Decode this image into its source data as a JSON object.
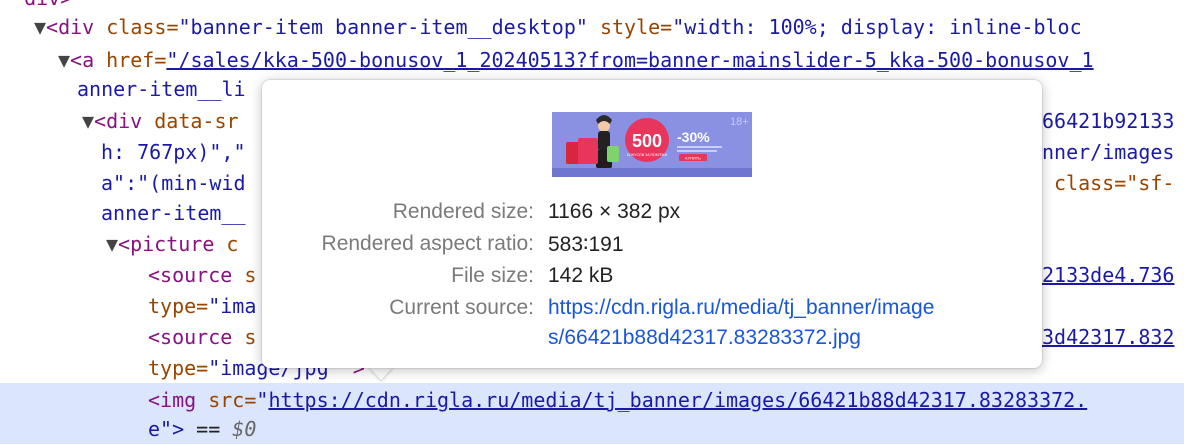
{
  "dom_lines": [
    {
      "indent": "  ",
      "arrow": "",
      "text_a": "div>",
      "cls": "tag"
    },
    {
      "arrow": "▼",
      "tag": "<div",
      "a1": " class=",
      "v1": "\"banner-item banner-item__desktop\"",
      "a2": " style=",
      "v2": "\"width: 100%; display: inline-bloc"
    },
    {
      "arrow": "▼",
      "tag": "<a",
      "a1": " href=",
      "v1": "\"/sales/kka-500-bonusov_1_20240513?from=banner-mainslider-5_kka-500-bonusov_1"
    },
    {
      "text": "anner-item__li"
    },
    {
      "arrow": "▼",
      "tag": "<div",
      "a1": " data-sr",
      "right": "66421b92133"
    },
    {
      "text": "h: 767px)\",\"",
      "right": "nner/images"
    },
    {
      "text": "a\":\"(min-wid",
      "right": "class=\"sf-"
    },
    {
      "text": "anner-item__"
    },
    {
      "arrow": "▼",
      "tag": "<picture",
      "tail": " c"
    },
    {
      "tag": "<source",
      "tail": " s",
      "right": "2133de4.736"
    },
    {
      "a1": "type=",
      "v1": "\"ima"
    },
    {
      "tag": "<source",
      "tail": " s",
      "right": "3d42317.832"
    },
    {
      "a1": "type=",
      "v1": "\"image/jpg\"",
      "tail": " >"
    },
    {
      "tag": "<img",
      "a1": " src=",
      "v1": "\"",
      "link": "https://cdn.rigla.ru/media/tj_banner/images/66421b88d42317.83283372."
    },
    {
      "text": "e\">",
      "eq": " == ",
      "dollar": "$0"
    }
  ],
  "tooltip": {
    "thumbnail": {
      "big_number": "500",
      "sub_text": "БОНУСОВ ЗА ПОКУПКИ",
      "discount": "-30%",
      "age": "18+",
      "button": "КУПИТЬ",
      "colors": {
        "bg": "#8a90e2",
        "circle": "#e8355c",
        "badge": "#e8355c"
      }
    },
    "rows": [
      {
        "key": "Rendered size:",
        "value": "1166 × 382 px"
      },
      {
        "key": "Rendered aspect ratio:",
        "value": "583∶191"
      },
      {
        "key": "File size:",
        "value": "142 kB"
      },
      {
        "key": "Current source:",
        "value_line1": "https://cdn.rigla.ru/media/tj_banner/image",
        "value_line2": "s/66421b88d42317.83283372.jpg"
      }
    ]
  },
  "colors": {
    "highlight": "#dbe5fb",
    "tag": "#881280",
    "attr": "#994500",
    "value": "#1a1aa6",
    "link": "#1a56db"
  }
}
